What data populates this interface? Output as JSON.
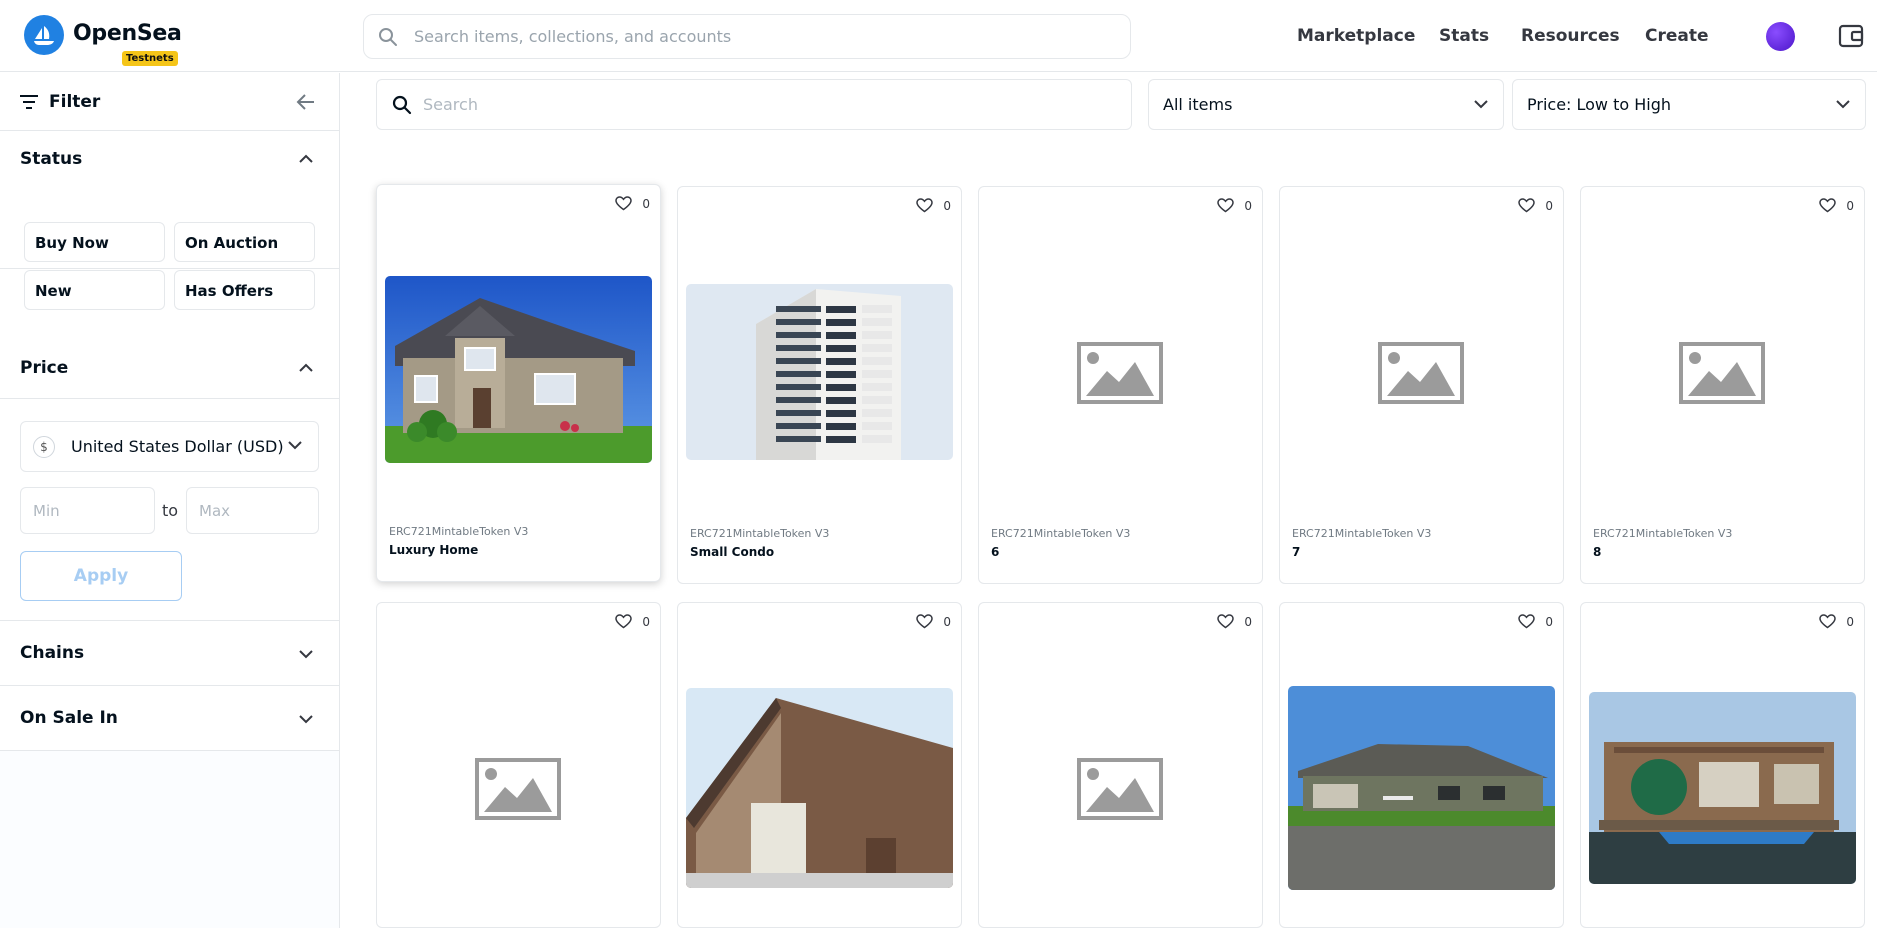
{
  "header": {
    "brand": "OpenSea",
    "badge": "Testnets",
    "search_placeholder": "Search items, collections, and accounts",
    "nav": [
      "Marketplace",
      "Stats",
      "Resources",
      "Create"
    ]
  },
  "sidebar": {
    "filter_label": "Filter",
    "status": {
      "title": "Status",
      "options": [
        "Buy Now",
        "On Auction",
        "New",
        "Has Offers"
      ]
    },
    "price": {
      "title": "Price",
      "currency_symbol": "$",
      "currency": "United States Dollar (USD)",
      "min_placeholder": "Min",
      "to_label": "to",
      "max_placeholder": "Max",
      "apply_label": "Apply"
    },
    "chains_title": "Chains",
    "on_sale_title": "On Sale In"
  },
  "main": {
    "search_placeholder": "Search",
    "items_filter": "All items",
    "sort": "Price: Low to High"
  },
  "cards": [
    {
      "contract": "ERC721MintableToken V3",
      "name": "Luxury Home",
      "likes": "0",
      "image": "house-photo"
    },
    {
      "contract": "ERC721MintableToken V3",
      "name": "Small Condo",
      "likes": "0",
      "image": "condo-photo"
    },
    {
      "contract": "ERC721MintableToken V3",
      "name": "6",
      "likes": "0",
      "image": "placeholder-icon"
    },
    {
      "contract": "ERC721MintableToken V3",
      "name": "7",
      "likes": "0",
      "image": "placeholder-icon"
    },
    {
      "contract": "ERC721MintableToken V3",
      "name": "8",
      "likes": "0",
      "image": "placeholder-icon"
    },
    {
      "likes": "0",
      "image": "placeholder-icon"
    },
    {
      "likes": "0",
      "image": "barn-photo"
    },
    {
      "likes": "0",
      "image": "placeholder-icon"
    },
    {
      "likes": "0",
      "image": "ranch-house-photo"
    },
    {
      "likes": "0",
      "image": "houseboat-photo"
    }
  ],
  "colors": {
    "brand_blue": "#2081e2",
    "badge_yellow": "#f5c518",
    "border": "#e5e8eb",
    "apply_disabled": "#a7cdf3"
  }
}
